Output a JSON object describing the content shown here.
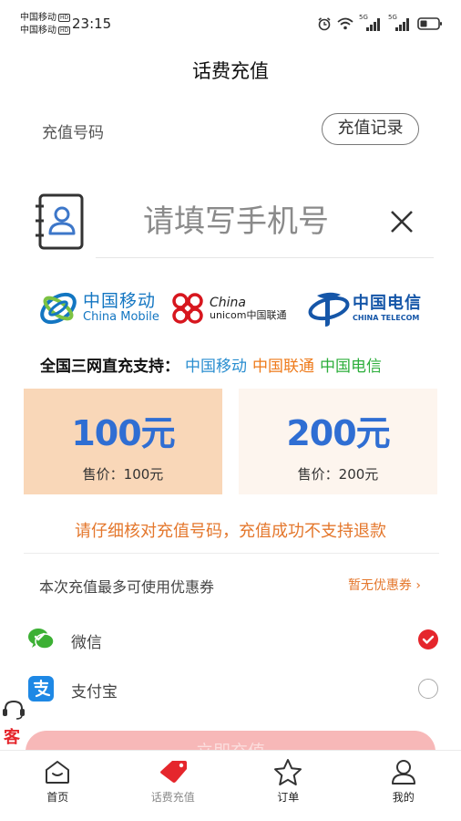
{
  "status_bar": {
    "carrier_1": "中国移动",
    "carrier_2": "中国移动",
    "hd_badge": "HD",
    "time": "23:15",
    "signal_1": "5G",
    "signal_2": "5G"
  },
  "header": {
    "title": "话费充值"
  },
  "recharge": {
    "number_label": "充值号码",
    "record_button": "充值记录",
    "phone_placeholder": "请填写手机号",
    "phone_value": ""
  },
  "carriers": {
    "cmcc": {
      "cn": "中国移动",
      "en": "China Mobile"
    },
    "unicom": {
      "cn": "China",
      "en": "unicom中国联通"
    },
    "telecom": {
      "cn": "中国电信",
      "en": "CHINA TELECOM"
    }
  },
  "support": {
    "label": "全国三网直充支持：",
    "cmcc": "中国移动",
    "unicom": "中国联通",
    "telecom": "中国电信"
  },
  "packages": [
    {
      "amount": "100元",
      "price": "售价：100元",
      "selected": true
    },
    {
      "amount": "200元",
      "price": "售价：200元",
      "selected": false
    }
  ],
  "warning": "请仔细核对充值号码，充值成功不支持退款",
  "coupon": {
    "label": "本次充值最多可使用优惠券",
    "status": "暂无优惠券 ›"
  },
  "payment_methods": [
    {
      "name": "微信",
      "icon": "wechat-icon",
      "selected": true
    },
    {
      "name": "支付宝",
      "icon": "alipay-icon",
      "selected": false
    }
  ],
  "service": {
    "label": "客"
  },
  "pay_button": {
    "label": "立即充值"
  },
  "tabbar": [
    {
      "label": "首页",
      "icon": "home-icon"
    },
    {
      "label": "话费充值",
      "icon": "tag-icon",
      "active": true
    },
    {
      "label": "订单",
      "icon": "star-icon"
    },
    {
      "label": "我的",
      "icon": "user-icon"
    }
  ],
  "colors": {
    "accent_blue": "#2f6ed3",
    "accent_orange": "#e4772c",
    "accent_red": "#e5262c",
    "card_selected": "#f9d7b8",
    "card_normal": "#fdf5ee"
  }
}
